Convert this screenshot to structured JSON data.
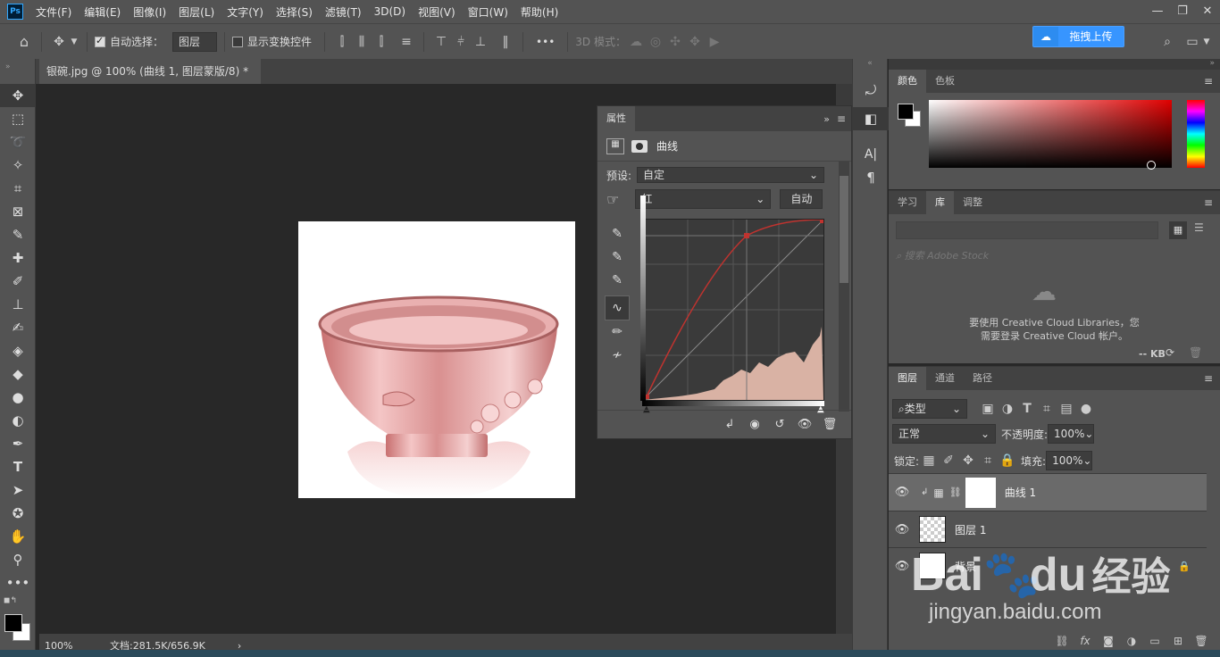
{
  "menubar": {
    "logo": "Ps",
    "items": [
      "文件(F)",
      "编辑(E)",
      "图像(I)",
      "图层(L)",
      "文字(Y)",
      "选择(S)",
      "滤镜(T)",
      "3D(D)",
      "视图(V)",
      "窗口(W)",
      "帮助(H)"
    ]
  },
  "options": {
    "auto_select_label": "自动选择：",
    "auto_select_value": "图层",
    "show_transform_label": "显示变换控件",
    "mode_3d_label": "3D 模式：",
    "more": "•••"
  },
  "baidu_upload": {
    "label": "拖拽上传"
  },
  "document": {
    "tab_title": "银碗.jpg @ 100% (曲线 1, 图层蒙版/8) *",
    "close": "×",
    "zoom": "100%",
    "doc_size": "文档:281.5K/656.9K",
    "arrow": "›"
  },
  "properties": {
    "tab": "属性",
    "title": "曲线",
    "preset_label": "预设:",
    "preset_value": "自定",
    "channel_value": "红",
    "auto_button": "自动"
  },
  "color_panel": {
    "tabs": [
      "颜色",
      "色板"
    ],
    "colors": {
      "foreground": "#000000",
      "background": "#ffffff",
      "hue": "#ff0000"
    }
  },
  "library_panel": {
    "tabs": [
      "学习",
      "库",
      "调整"
    ],
    "search_placeholder": "搜索 Adobe Stock",
    "message_line1": "要使用 Creative Cloud Libraries，您",
    "message_line2": "需要登录 Creative Cloud 帐户。",
    "kb": "-- KB"
  },
  "layers_panel": {
    "tabs": [
      "图层",
      "通道",
      "路径"
    ],
    "filter_value": "类型",
    "blend_mode": "正常",
    "opacity_label": "不透明度:",
    "opacity_value": "100%",
    "lock_label": "锁定:",
    "fill_label": "填充:",
    "fill_value": "100%",
    "layers": [
      {
        "name": "曲线 1"
      },
      {
        "name": "图层 1"
      },
      {
        "name": "背景"
      }
    ]
  },
  "watermark": {
    "brand": "Bai",
    "brand2": "du",
    "cn": "经验",
    "url": "jingyan.baidu.com"
  }
}
